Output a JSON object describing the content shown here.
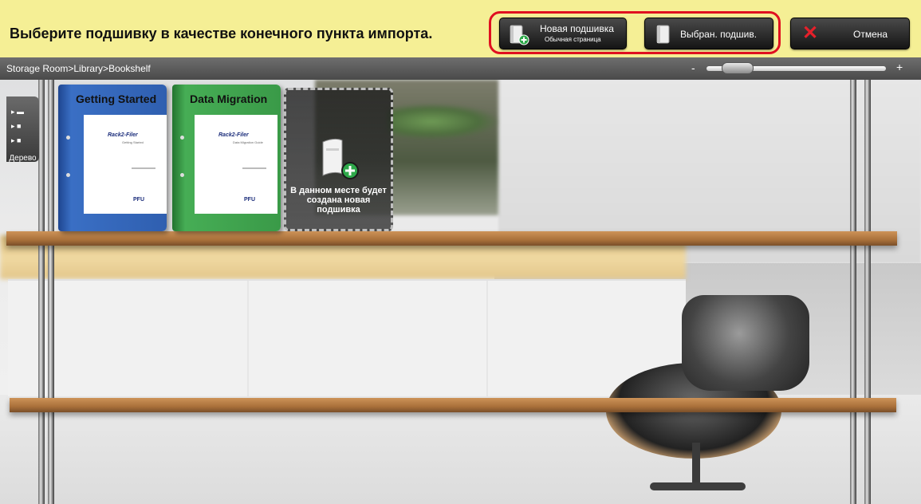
{
  "toolbar": {
    "prompt": "Выберите подшивку в качестве конечного пункта импорта.",
    "new_binder": {
      "label": "Новая подшивка",
      "sublabel": "Обычная страница"
    },
    "selected_binder": {
      "label": "Выбран. подшив."
    },
    "cancel": {
      "label": "Отмена"
    },
    "highlight_color": "#e01020"
  },
  "pathbar": {
    "breadcrumb": "Storage Room>Library>Bookshelf",
    "zoom_minus": "-",
    "zoom_plus": "+",
    "zoom_level": 0.1
  },
  "tree_panel": {
    "label": "Дерево",
    "icons": [
      "folder-open-icon",
      "folder-icon",
      "folder-icon"
    ]
  },
  "bookshelf": {
    "binders": [
      {
        "title": "Getting Started",
        "color": "#2f5fb0",
        "paper_logo": "Rack2-Filer",
        "paper_sub": "Getting Started",
        "paper_brand": "PFU"
      },
      {
        "title": "Data Migration",
        "color": "#3a9a48",
        "paper_logo": "Rack2-Filer",
        "paper_sub": "Data Migration Guide",
        "paper_brand": "PFU"
      }
    ],
    "new_slot_text": "В данном месте будет создана новая подшивка"
  }
}
